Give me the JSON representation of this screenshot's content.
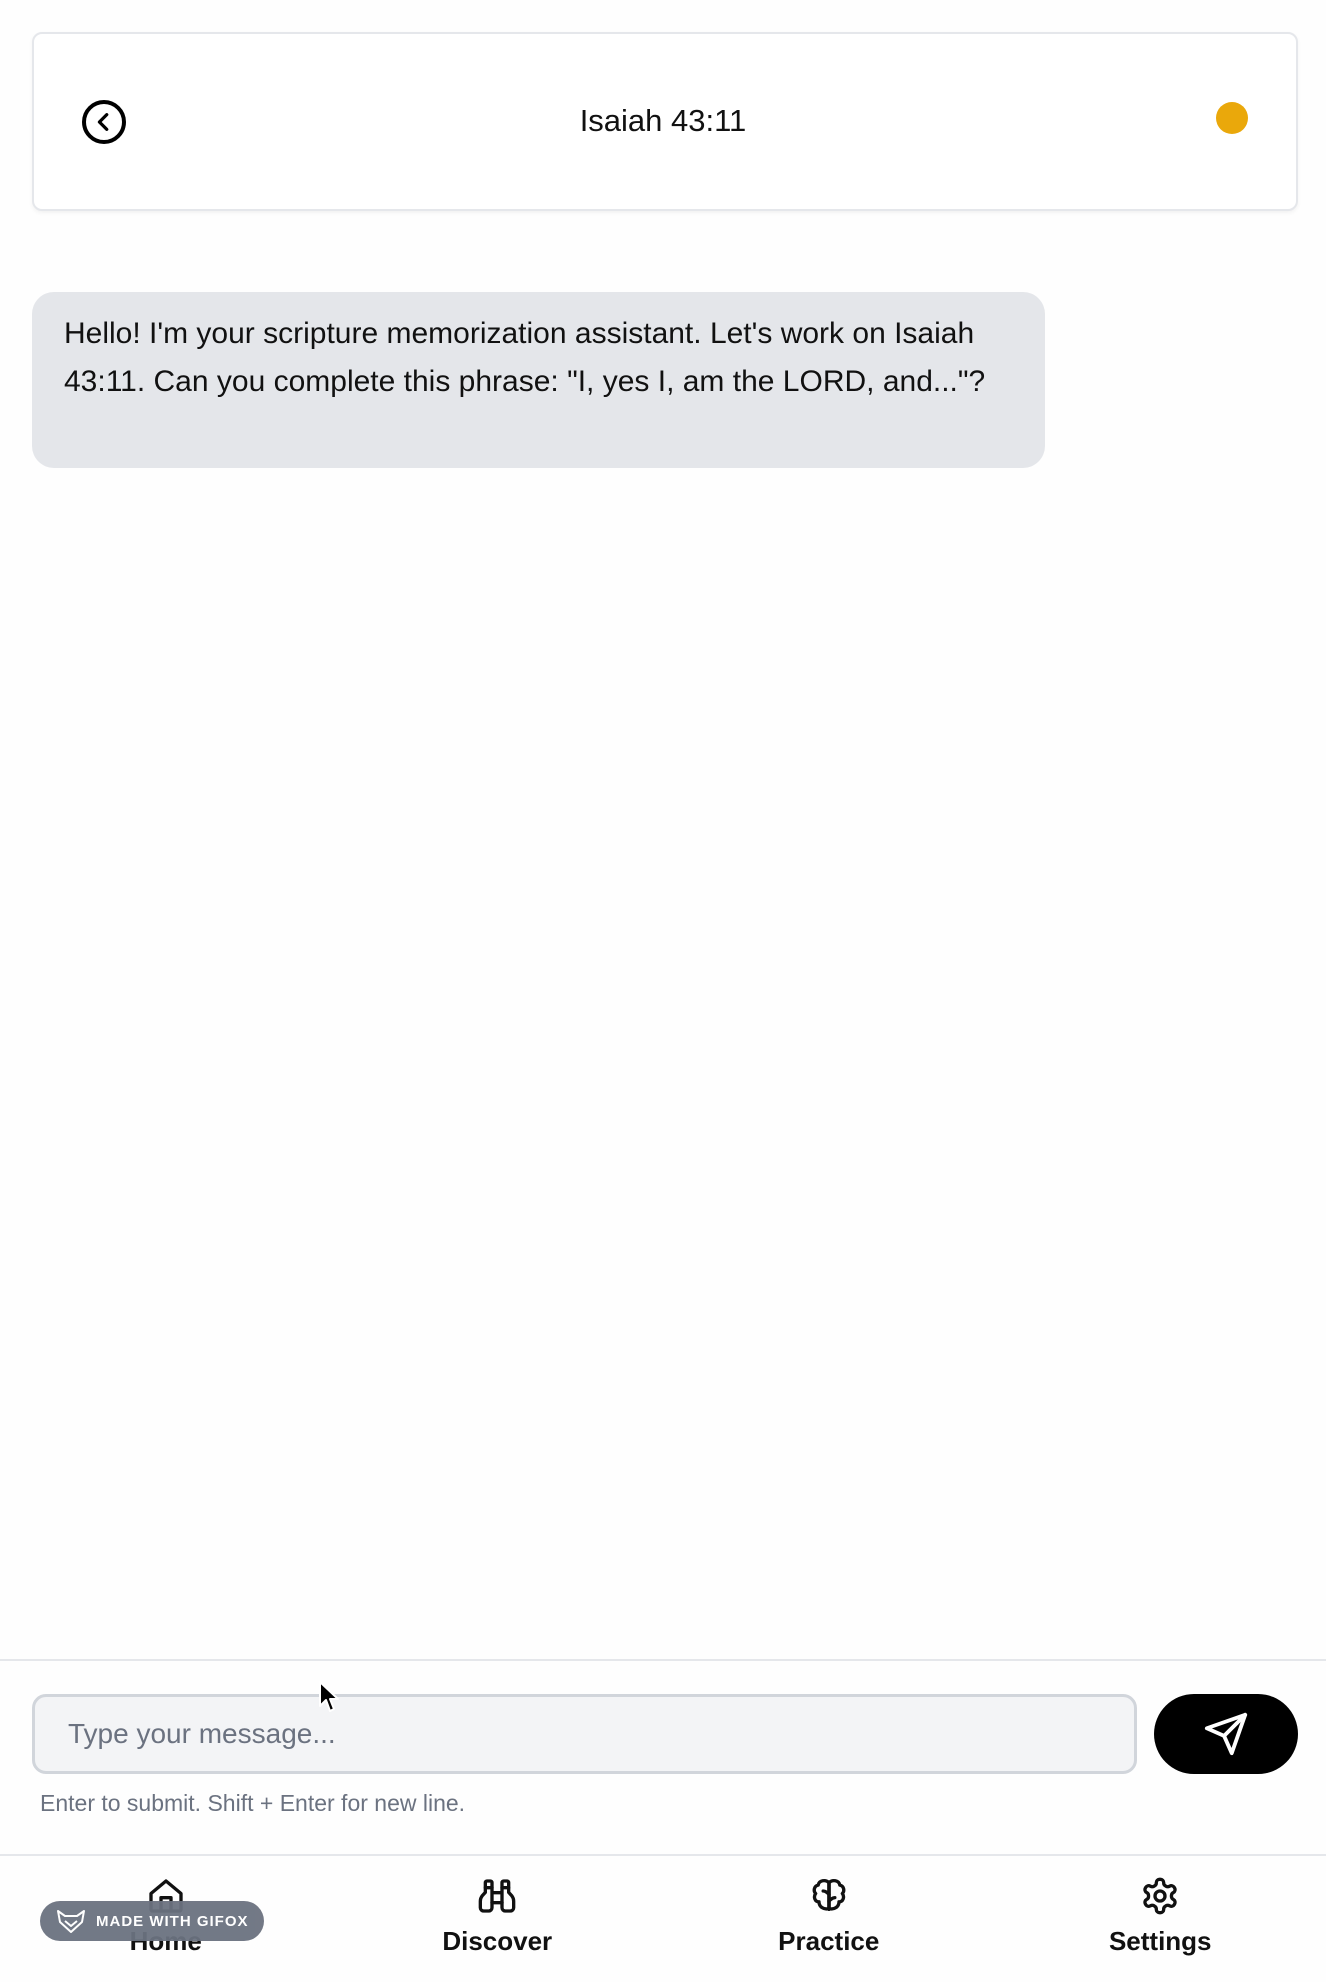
{
  "header": {
    "title": "Isaiah 43:11",
    "back_icon": "chevron-left-circle-icon",
    "status_color": "#eaa80b"
  },
  "chat": {
    "messages": [
      {
        "role": "assistant",
        "text": "Hello! I'm your scripture memorization assistant. Let's work on Isaiah 43:11. Can you complete this phrase: \"I, yes I, am the LORD, and...\"?"
      }
    ]
  },
  "composer": {
    "placeholder": "Type your message...",
    "value": "",
    "send_icon": "send-icon",
    "hint": "Enter to submit. Shift + Enter for new line."
  },
  "nav": {
    "items": [
      {
        "label": "Home",
        "icon": "home-icon"
      },
      {
        "label": "Discover",
        "icon": "binoculars-icon"
      },
      {
        "label": "Practice",
        "icon": "brain-icon"
      },
      {
        "label": "Settings",
        "icon": "gear-icon"
      }
    ]
  },
  "watermark": {
    "text": "MADE WITH GIFOX"
  }
}
